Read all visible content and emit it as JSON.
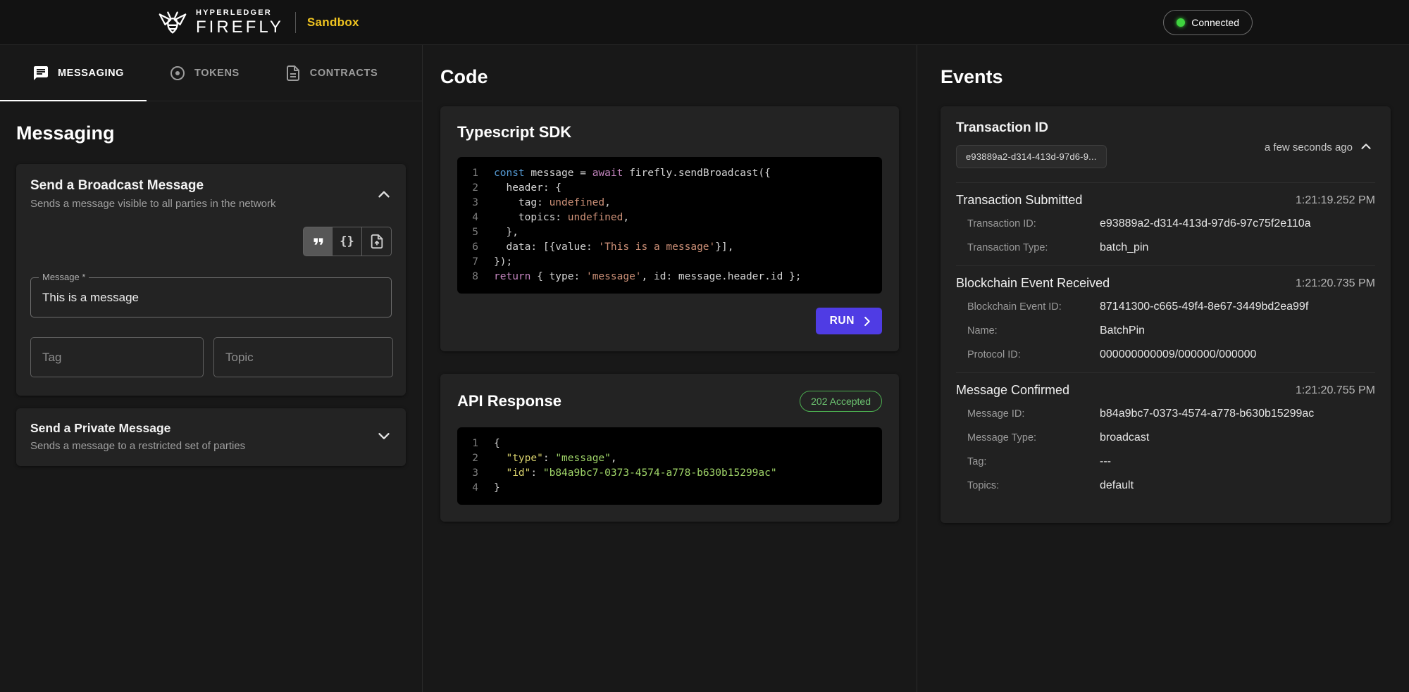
{
  "header": {
    "brand_top": "HYPERLEDGER",
    "brand_name": "FIREFLY",
    "app_name": "Sandbox",
    "connection_status": "Connected"
  },
  "tabs": [
    {
      "label": "MESSAGING",
      "icon": "chat-icon",
      "active": true
    },
    {
      "label": "TOKENS",
      "icon": "token-circle-icon",
      "active": false
    },
    {
      "label": "CONTRACTS",
      "icon": "contract-file-icon",
      "active": false
    }
  ],
  "messaging": {
    "page_title": "Messaging",
    "broadcast_card": {
      "title": "Send a Broadcast Message",
      "subtitle": "Sends a message visible to all parties in the network",
      "toolbar": {
        "braces_label": "{}"
      },
      "message_field": {
        "label": "Message *",
        "value": "This is a message"
      },
      "tag_placeholder": "Tag",
      "topic_placeholder": "Topic"
    },
    "private_card": {
      "title": "Send a Private Message",
      "subtitle": "Sends a message to a restricted set of parties"
    }
  },
  "code": {
    "section_title": "Code",
    "sdk_card": {
      "title": "Typescript SDK",
      "run_label": "RUN",
      "lines": [
        [
          [
            "const",
            "kw"
          ],
          [
            " message = ",
            "p"
          ],
          [
            "await",
            "kw2"
          ],
          [
            " firefly.sendBroadcast({",
            "p"
          ]
        ],
        [
          [
            "  header: {",
            "p"
          ]
        ],
        [
          [
            "    tag: ",
            "p"
          ],
          [
            "undefined",
            "str"
          ],
          [
            ",",
            "p"
          ]
        ],
        [
          [
            "    topics: ",
            "p"
          ],
          [
            "undefined",
            "str"
          ],
          [
            ",",
            "p"
          ]
        ],
        [
          [
            "  },",
            "p"
          ]
        ],
        [
          [
            "  data: [{value: ",
            "p"
          ],
          [
            "'This is a message'",
            "str"
          ],
          [
            "}],",
            "p"
          ]
        ],
        [
          [
            "});",
            "p"
          ]
        ],
        [
          [
            "return",
            "kw2"
          ],
          [
            " { type: ",
            "p"
          ],
          [
            "'message'",
            "str"
          ],
          [
            ", id: message.header.id };",
            "p"
          ]
        ]
      ]
    },
    "api_card": {
      "title": "API Response",
      "status": "202 Accepted",
      "lines": [
        [
          [
            "{",
            "p"
          ]
        ],
        [
          [
            "  \"type\"",
            "key"
          ],
          [
            ": ",
            "p"
          ],
          [
            "\"message\"",
            "val"
          ],
          [
            ",",
            "p"
          ]
        ],
        [
          [
            "  \"id\"",
            "key"
          ],
          [
            ": ",
            "p"
          ],
          [
            "\"b84a9bc7-0373-4574-a778-b630b15299ac\"",
            "val"
          ]
        ],
        [
          [
            "}",
            "p"
          ]
        ]
      ]
    }
  },
  "events": {
    "section_title": "Events",
    "card": {
      "title": "Transaction ID",
      "transaction_chip": "e93889a2-d314-413d-97d6-9...",
      "time_ago": "a few seconds ago",
      "groups": [
        {
          "title": "Transaction Submitted",
          "timestamp": "1:21:19.252 PM",
          "rows": [
            {
              "label": "Transaction ID:",
              "value": "e93889a2-d314-413d-97d6-97c75f2e110a"
            },
            {
              "label": "Transaction Type:",
              "value": "batch_pin"
            }
          ]
        },
        {
          "title": "Blockchain Event Received",
          "timestamp": "1:21:20.735 PM",
          "rows": [
            {
              "label": "Blockchain Event ID:",
              "value": "87141300-c665-49f4-8e67-3449bd2ea99f"
            },
            {
              "label": "Name:",
              "value": "BatchPin"
            },
            {
              "label": "Protocol ID:",
              "value": "000000000009/000000/000000"
            }
          ]
        },
        {
          "title": "Message Confirmed",
          "timestamp": "1:21:20.755 PM",
          "rows": [
            {
              "label": "Message ID:",
              "value": "b84a9bc7-0373-4574-a778-b630b15299ac"
            },
            {
              "label": "Message Type:",
              "value": "broadcast"
            },
            {
              "label": "Tag:",
              "value": "---"
            },
            {
              "label": "Topics:",
              "value": "default"
            }
          ]
        }
      ]
    }
  },
  "icons": [
    "firefly-bee-logo",
    "chat-icon",
    "token-circle-icon",
    "contract-file-icon",
    "quote-icon",
    "braces-icon",
    "upload-file-icon",
    "chevron-up-icon",
    "chevron-down-icon",
    "run-arrow-icon",
    "green-status-dot"
  ],
  "colors": {
    "accent_yellow": "#f0c420",
    "run_button": "#4f3ce4",
    "success_green": "#4caf50"
  }
}
